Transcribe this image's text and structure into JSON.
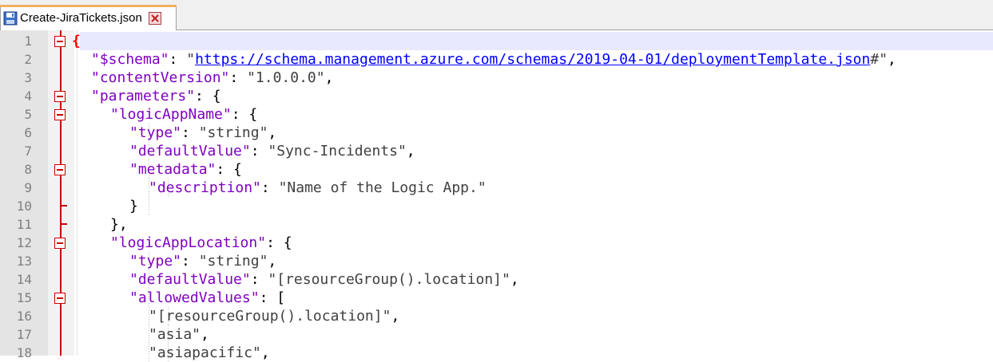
{
  "tab": {
    "title": "Create-JiraTickets.json",
    "save_icon": "floppy-disk-icon",
    "close_icon": "close-x-icon"
  },
  "colors": {
    "key": "#8000c0",
    "string": "#404040",
    "link": "#0000ff",
    "fold_marker": "#c80000",
    "current_line": "#e8e8ff"
  },
  "lines": [
    {
      "n": "1",
      "indent": 0,
      "fold": "open",
      "current": true,
      "tokens": [
        {
          "t": "{",
          "k": "brace-open"
        }
      ]
    },
    {
      "n": "2",
      "indent": 1,
      "fold": "none",
      "tokens": [
        {
          "t": "\"$schema\"",
          "k": "key"
        },
        {
          "t": ": ",
          "k": "punc"
        },
        {
          "t": "\"",
          "k": "str"
        },
        {
          "t": "https://schema.management.azure.com/schemas/2019-04-01/deploymentTemplate.json",
          "k": "link"
        },
        {
          "t": "#\"",
          "k": "str"
        },
        {
          "t": ",",
          "k": "punc"
        }
      ]
    },
    {
      "n": "3",
      "indent": 1,
      "fold": "none",
      "tokens": [
        {
          "t": "\"contentVersion\"",
          "k": "key"
        },
        {
          "t": ": ",
          "k": "punc"
        },
        {
          "t": "\"1.0.0.0\"",
          "k": "str"
        },
        {
          "t": ",",
          "k": "punc"
        }
      ]
    },
    {
      "n": "4",
      "indent": 1,
      "fold": "open",
      "tokens": [
        {
          "t": "\"parameters\"",
          "k": "key"
        },
        {
          "t": ": {",
          "k": "punc"
        }
      ]
    },
    {
      "n": "5",
      "indent": 2,
      "fold": "open",
      "tokens": [
        {
          "t": "\"logicAppName\"",
          "k": "key"
        },
        {
          "t": ": {",
          "k": "punc"
        }
      ]
    },
    {
      "n": "6",
      "indent": 3,
      "fold": "none",
      "tokens": [
        {
          "t": "\"type\"",
          "k": "key"
        },
        {
          "t": ": ",
          "k": "punc"
        },
        {
          "t": "\"string\"",
          "k": "str"
        },
        {
          "t": ",",
          "k": "punc"
        }
      ]
    },
    {
      "n": "7",
      "indent": 3,
      "fold": "none",
      "tokens": [
        {
          "t": "\"defaultValue\"",
          "k": "key"
        },
        {
          "t": ": ",
          "k": "punc"
        },
        {
          "t": "\"Sync-Incidents\"",
          "k": "str"
        },
        {
          "t": ",",
          "k": "punc"
        }
      ]
    },
    {
      "n": "8",
      "indent": 3,
      "fold": "open",
      "tokens": [
        {
          "t": "\"metadata\"",
          "k": "key"
        },
        {
          "t": ": {",
          "k": "punc"
        }
      ]
    },
    {
      "n": "9",
      "indent": 4,
      "fold": "none",
      "tokens": [
        {
          "t": "\"description\"",
          "k": "key"
        },
        {
          "t": ": ",
          "k": "punc"
        },
        {
          "t": "\"Name of the Logic App.\"",
          "k": "str"
        }
      ]
    },
    {
      "n": "10",
      "indent": 3,
      "fold": "end",
      "tokens": [
        {
          "t": "}",
          "k": "punc"
        }
      ]
    },
    {
      "n": "11",
      "indent": 2,
      "fold": "end",
      "tokens": [
        {
          "t": "},",
          "k": "punc"
        }
      ]
    },
    {
      "n": "12",
      "indent": 2,
      "fold": "open",
      "tokens": [
        {
          "t": "\"logicAppLocation\"",
          "k": "key"
        },
        {
          "t": ": {",
          "k": "punc"
        }
      ]
    },
    {
      "n": "13",
      "indent": 3,
      "fold": "none",
      "tokens": [
        {
          "t": "\"type\"",
          "k": "key"
        },
        {
          "t": ": ",
          "k": "punc"
        },
        {
          "t": "\"string\"",
          "k": "str"
        },
        {
          "t": ",",
          "k": "punc"
        }
      ]
    },
    {
      "n": "14",
      "indent": 3,
      "fold": "none",
      "tokens": [
        {
          "t": "\"defaultValue\"",
          "k": "key"
        },
        {
          "t": ": ",
          "k": "punc"
        },
        {
          "t": "\"[resourceGroup().location]\"",
          "k": "str"
        },
        {
          "t": ",",
          "k": "punc"
        }
      ]
    },
    {
      "n": "15",
      "indent": 3,
      "fold": "open",
      "tokens": [
        {
          "t": "\"allowedValues\"",
          "k": "key"
        },
        {
          "t": ": [",
          "k": "punc"
        }
      ]
    },
    {
      "n": "16",
      "indent": 4,
      "fold": "none",
      "tokens": [
        {
          "t": "\"[resourceGroup().location]\"",
          "k": "str"
        },
        {
          "t": ",",
          "k": "punc"
        }
      ]
    },
    {
      "n": "17",
      "indent": 4,
      "fold": "none",
      "tokens": [
        {
          "t": "\"asia\"",
          "k": "str"
        },
        {
          "t": ",",
          "k": "punc"
        }
      ]
    },
    {
      "n": "18",
      "indent": 4,
      "fold": "none",
      "tokens": [
        {
          "t": "\"asiapacific\"",
          "k": "str"
        },
        {
          "t": ",",
          "k": "punc"
        }
      ]
    }
  ]
}
